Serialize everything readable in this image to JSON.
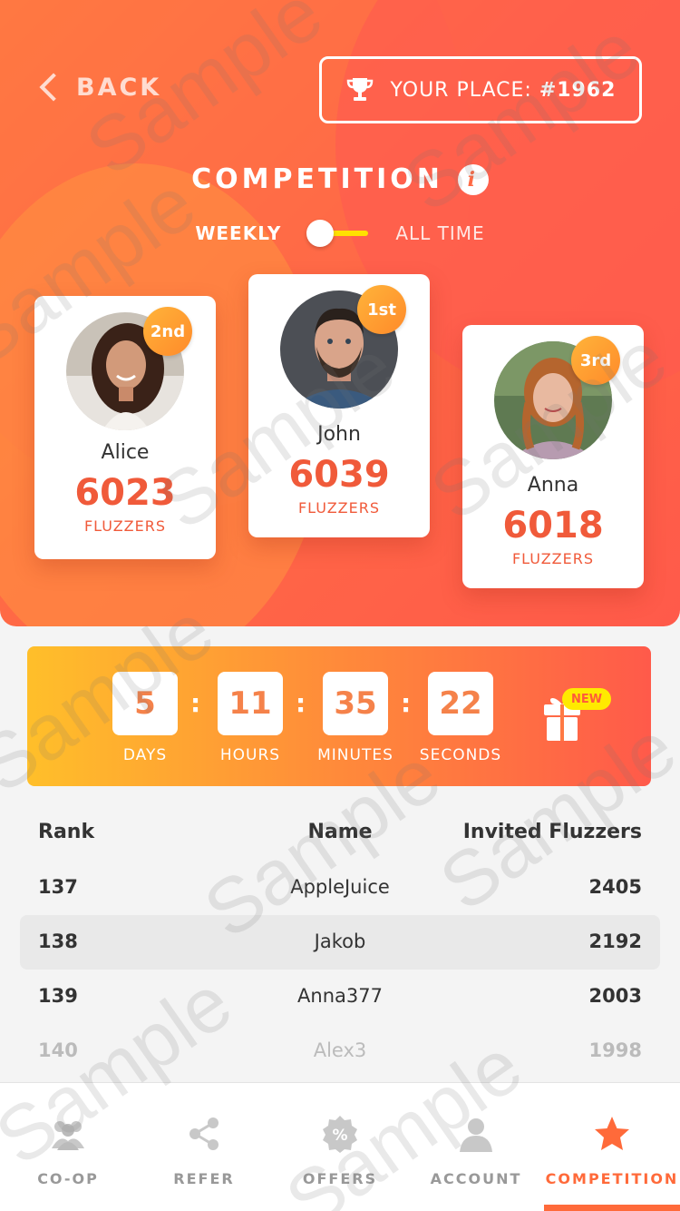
{
  "header": {
    "back_label": "BACK",
    "place_label": "YOUR PLACE: ",
    "place_value": "#1962"
  },
  "competition": {
    "title": "COMPETITION",
    "info_glyph": "i",
    "toggle_left": "WEEKLY",
    "toggle_right": "ALL TIME"
  },
  "podium": [
    {
      "rank_badge": "2nd",
      "name": "Alice",
      "score": "6023",
      "unit": "FLUZZERS"
    },
    {
      "rank_badge": "1st",
      "name": "John",
      "score": "6039",
      "unit": "FLUZZERS"
    },
    {
      "rank_badge": "3rd",
      "name": "Anna",
      "score": "6018",
      "unit": "FLUZZERS"
    }
  ],
  "timer": {
    "units": [
      {
        "value": "5",
        "label": "DAYS"
      },
      {
        "value": "11",
        "label": "HOURS"
      },
      {
        "value": "35",
        "label": "MINUTES"
      },
      {
        "value": "22",
        "label": "SECONDS"
      }
    ],
    "separator": ":",
    "new_badge": "NEW"
  },
  "table": {
    "headers": {
      "rank": "Rank",
      "name": "Name",
      "value": "Invited Fluzzers"
    },
    "rows": [
      {
        "rank": "137",
        "name": "AppleJuice",
        "value": "2405"
      },
      {
        "rank": "138",
        "name": "Jakob",
        "value": "2192"
      },
      {
        "rank": "139",
        "name": "Anna377",
        "value": "2003"
      },
      {
        "rank": "140",
        "name": "Alex3",
        "value": "1998"
      }
    ]
  },
  "nav": [
    {
      "label": "CO-OP",
      "icon": "group-icon"
    },
    {
      "label": "REFER",
      "icon": "share-icon"
    },
    {
      "label": "OFFERS",
      "icon": "percent-badge-icon"
    },
    {
      "label": "ACCOUNT",
      "icon": "person-icon"
    },
    {
      "label": "COMPETITION",
      "icon": "star-icon"
    }
  ],
  "watermark": "Sample",
  "colors": {
    "accent": "#ff6a3a",
    "score": "#f05a3a",
    "toggle_track": "#ffe100",
    "new_badge": "#ffea00"
  }
}
